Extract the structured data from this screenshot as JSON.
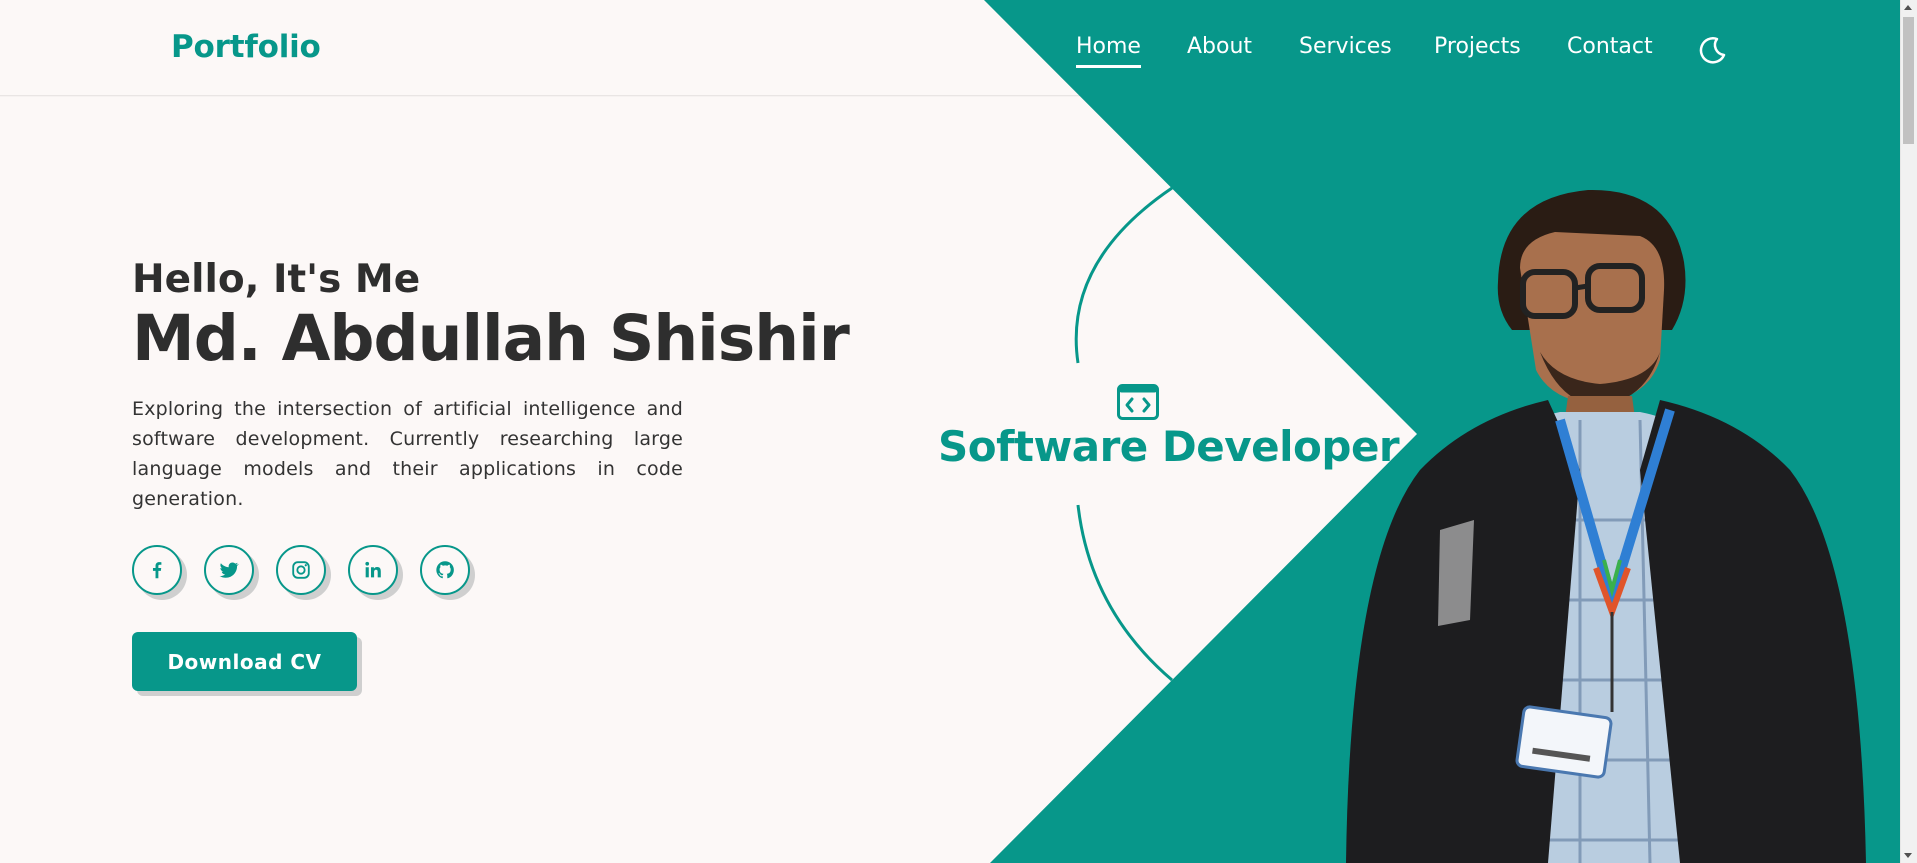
{
  "colors": {
    "accent": "#07978a",
    "background": "#fcf8f7",
    "text": "#2e2e2e"
  },
  "header": {
    "logo": "Portfolio",
    "nav": [
      {
        "label": "Home",
        "active": true
      },
      {
        "label": "About"
      },
      {
        "label": "Services"
      },
      {
        "label": "Projects"
      },
      {
        "label": "Contact"
      }
    ],
    "theme_toggle_icon": "moon-icon"
  },
  "hero": {
    "greeting": "Hello, It's Me",
    "name": "Md. Abdullah Shishir",
    "description": "Exploring the intersection of artificial intelligence and software development. Currently researching large language models and their applications in code generation.",
    "socials": [
      {
        "icon": "facebook-icon"
      },
      {
        "icon": "twitter-icon"
      },
      {
        "icon": "instagram-icon"
      },
      {
        "icon": "linkedin-icon"
      },
      {
        "icon": "github-icon"
      }
    ],
    "cv_button": "Download CV",
    "role": "Software Developer",
    "role_icon": "code-window-icon"
  }
}
